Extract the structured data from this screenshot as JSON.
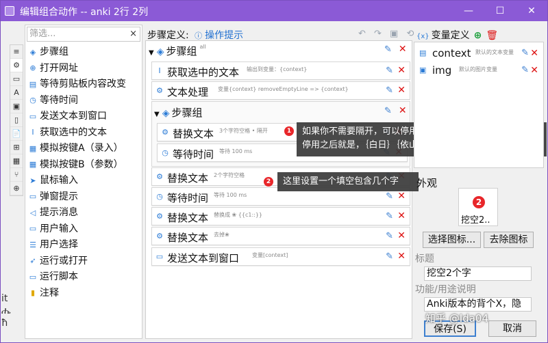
{
  "window": {
    "title": "编辑组合动作 -- anki 2行 2列",
    "controls": [
      "—",
      "☐",
      "✕"
    ]
  },
  "left": {
    "filter_placeholder": "筛选...",
    "filter_clear": "×",
    "strip": [
      "≡",
      "⚙",
      "▭",
      "A",
      "▣",
      "▯",
      "📄",
      "⊞",
      "▦",
      "⑂",
      "⊕"
    ],
    "items": [
      {
        "label": "步骤组",
        "icon": "layers-icon",
        "glyph": "◈"
      },
      {
        "label": "打开网址",
        "icon": "globe-icon",
        "glyph": "⊕"
      },
      {
        "label": "等待剪贴板内容改变",
        "icon": "clipboard-icon",
        "glyph": "▤"
      },
      {
        "label": "等待时间",
        "icon": "clock-icon",
        "glyph": "◷"
      },
      {
        "label": "发送文本到窗口",
        "icon": "message-icon",
        "glyph": "▭"
      },
      {
        "label": "获取选中的文本",
        "icon": "text-cursor-icon",
        "glyph": "I"
      },
      {
        "label": "模拟按键A（录入）",
        "icon": "keyboard-icon",
        "glyph": "▦"
      },
      {
        "label": "模拟按键B（参数）",
        "icon": "keyboard-icon",
        "glyph": "▦"
      },
      {
        "label": "鼠标输入",
        "icon": "cursor-icon",
        "glyph": "➤"
      },
      {
        "label": "弹窗提示",
        "icon": "popup-icon",
        "glyph": "▭"
      },
      {
        "label": "提示消息",
        "icon": "megaphone-icon",
        "glyph": "◁"
      },
      {
        "label": "用户输入",
        "icon": "input-icon",
        "glyph": "▭"
      },
      {
        "label": "用户选择",
        "icon": "list-icon",
        "glyph": "☰"
      },
      {
        "label": "运行或打开",
        "icon": "send-icon",
        "glyph": "➶"
      },
      {
        "label": "运行脚本",
        "icon": "script-icon",
        "glyph": "▭"
      },
      {
        "label": "注释",
        "icon": "note-icon",
        "glyph": "▮"
      }
    ],
    "edge_chars": [
      "it",
      "ሔ",
      "ħ"
    ]
  },
  "steps": {
    "label": "步骤定义:",
    "hint": "操作提示",
    "tools": "↶ ↷ ▣ ⟲",
    "group_outer": {
      "label": "步骤组",
      "desc": "all"
    },
    "get_text": {
      "label": "获取选中的文本",
      "desc": "输出到变量：{context}"
    },
    "text_process": {
      "label": "文本处理",
      "desc": "变量{context} removeEmptyLine => {context}"
    },
    "group_inner": {
      "label": "步骤组"
    },
    "replace1": {
      "label": "替换文本",
      "desc": "3个字符空格 • 隔开"
    },
    "wait1": {
      "label": "等待时间",
      "desc": "等待 100 ms"
    },
    "replace2": {
      "label": "替换文本",
      "desc": "2个字符空格"
    },
    "wait2": {
      "label": "等待时间",
      "desc": "等待 100 ms"
    },
    "replace3": {
      "label": "替换文本",
      "desc": "替换成 ❀ {{c1::}}"
    },
    "replace4": {
      "label": "替换文本",
      "desc": "去掉❀"
    },
    "send_text": {
      "label": "发送文本到窗口",
      "desc": "变量[context]"
    }
  },
  "tips": {
    "tip1_badge": "1",
    "tip1_line1": "如果你不需要隔开，可以停用。",
    "tip1_line2": "停用之后就是，｛白日｝｛依山｝尽，可以自己测试",
    "tip2_badge": "2",
    "tip2_line1": "这里设置一个填空包含几个字"
  },
  "vars": {
    "label": "变量定义",
    "items": [
      {
        "name": "context",
        "desc": "默认的文本变量"
      },
      {
        "name": "img",
        "desc": "默认的图片变量"
      }
    ]
  },
  "appearance": {
    "label": "外观",
    "icon_badge": "2",
    "icon_text": "挖空2..",
    "choose_icon": "选择图标...",
    "remove_icon": "去除图标",
    "title_label": "标题",
    "title_value": "挖空2个字",
    "desc_label": "功能/用途说明",
    "desc_value": "Anki版本的背个X，隐",
    "save": "保存(S)",
    "cancel": "取消",
    "watermark": "知乎 @Ida04"
  },
  "colors": {
    "titlebar": "#8b5ad6",
    "accent": "#2b7bd6",
    "danger": "#d11111"
  }
}
